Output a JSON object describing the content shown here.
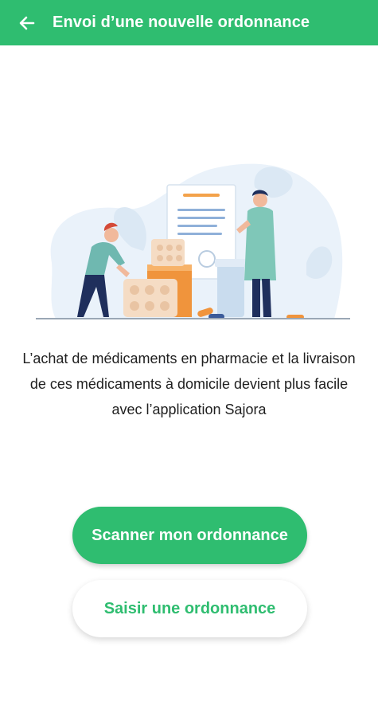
{
  "app_bar": {
    "title": "Envoi d’une nouvelle ordonnance",
    "back_icon": "arrow-left-icon"
  },
  "colors": {
    "primary": "#2fbd70",
    "background": "#ffffff",
    "text": "#1f1f1f"
  },
  "illustration": {
    "name": "pharmacy-illustration"
  },
  "main": {
    "description": "L’achat de médicaments en pharmacie et la livraison de ces médicaments à domicile devient plus facile avec l’application Sajora"
  },
  "actions": {
    "scan_label": "Scanner mon ordonnance",
    "enter_label": "Saisir une ordonnance"
  }
}
